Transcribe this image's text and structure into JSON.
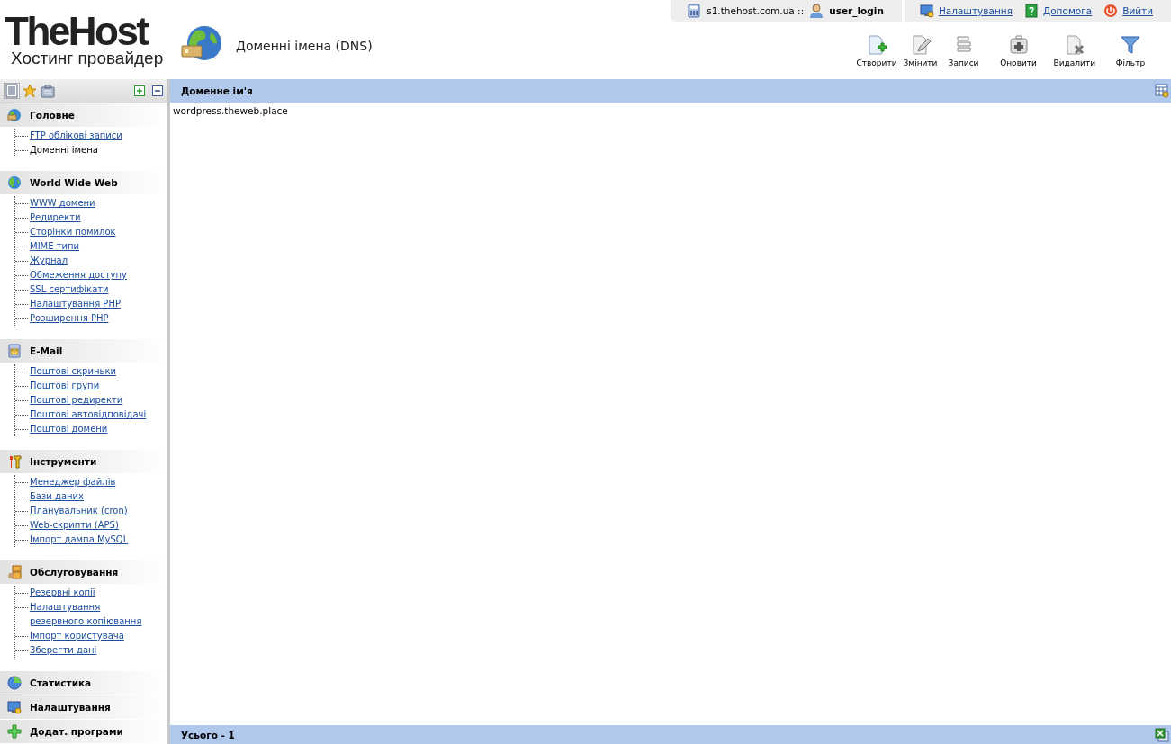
{
  "logo": {
    "name": "TheHost",
    "tagline": "Хостинг провайдер"
  },
  "page_title": "Доменні імена (DNS)",
  "top_bar": {
    "server": "s1.thehost.com.ua ::",
    "user": "user_login",
    "links": [
      "Налаштування",
      "Допомога",
      "Вийти"
    ]
  },
  "toolbar": [
    "Створити",
    "Змінити",
    "Записи",
    "Оновити",
    "Видалити",
    "Фільтр"
  ],
  "sidebar": {
    "sections": [
      {
        "title": "Головне",
        "items": [
          {
            "label": "FTP облікові записи",
            "selected": false
          },
          {
            "label": "Доменні імена",
            "selected": true
          }
        ]
      },
      {
        "title": "World Wide Web",
        "items": [
          {
            "label": "WWW домени",
            "selected": false
          },
          {
            "label": "Редиректи",
            "selected": false
          },
          {
            "label": "Сторінки помилок",
            "selected": false
          },
          {
            "label": "MIME типи",
            "selected": false
          },
          {
            "label": "Журнал",
            "selected": false
          },
          {
            "label": "Обмеження доступу",
            "selected": false
          },
          {
            "label": "SSL сертифікати",
            "selected": false
          },
          {
            "label": "Налаштування PHP",
            "selected": false
          },
          {
            "label": "Розширення PHP",
            "selected": false
          }
        ]
      },
      {
        "title": "E-Mail",
        "items": [
          {
            "label": "Поштові скриньки",
            "selected": false
          },
          {
            "label": "Поштові групи",
            "selected": false
          },
          {
            "label": "Поштові редиректи",
            "selected": false
          },
          {
            "label": "Поштові автовідповідачі",
            "selected": false
          },
          {
            "label": "Поштові домени",
            "selected": false
          }
        ]
      },
      {
        "title": "Інструменти",
        "items": [
          {
            "label": "Менеджер файлів",
            "selected": false
          },
          {
            "label": "Бази даних",
            "selected": false
          },
          {
            "label": "Планувальник (cron)",
            "selected": false
          },
          {
            "label": "Web-скрипти (APS)",
            "selected": false
          },
          {
            "label": "Імпорт дампа MySQL",
            "selected": false
          }
        ]
      },
      {
        "title": "Обслуговування",
        "items": [
          {
            "label": "Резервні копії",
            "selected": false
          },
          {
            "label": "Налаштування резервного копіювання",
            "selected": false
          },
          {
            "label": "Імпорт користувача",
            "selected": false
          },
          {
            "label": "Зберегти дані",
            "selected": false
          }
        ]
      },
      {
        "title": "Статистика"
      },
      {
        "title": "Налаштування"
      },
      {
        "title": "Додат. програми"
      }
    ]
  },
  "table": {
    "columns": [
      "Доменне ім'я"
    ],
    "rows": [
      [
        "wordpress.theweb.place"
      ]
    ],
    "footer": "Усього - 1"
  }
}
